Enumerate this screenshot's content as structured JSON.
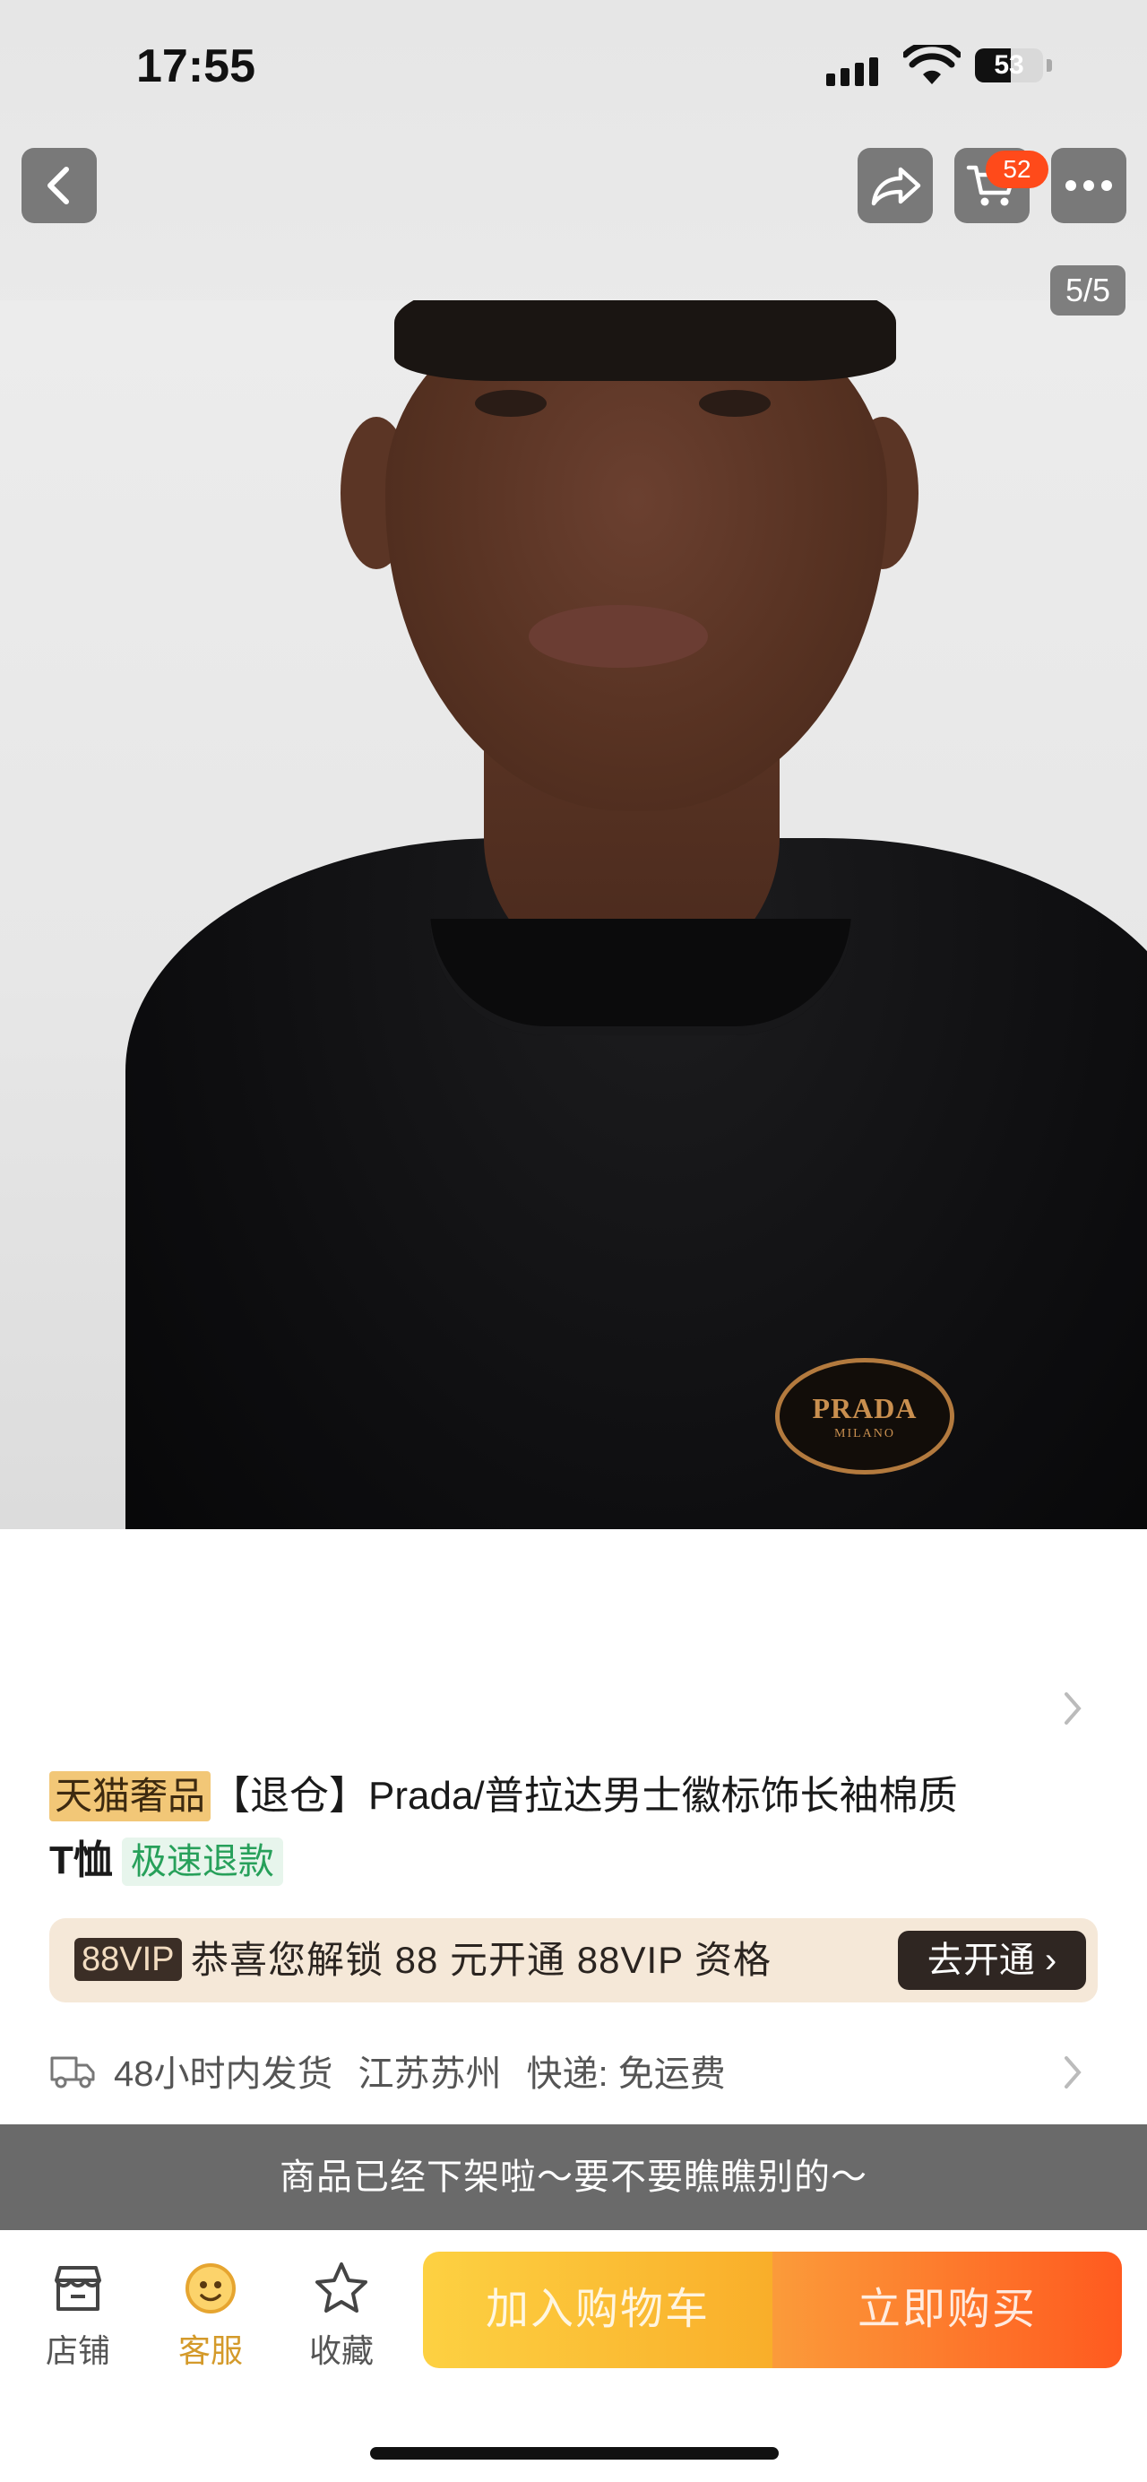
{
  "status_bar": {
    "time": "17:55",
    "battery": "53",
    "battery_level": 0.53
  },
  "header": {
    "cart_count": "52",
    "page_indicator": "5/5"
  },
  "product_image": {
    "badge_brand": "PRADA",
    "badge_city": "MILANO"
  },
  "product": {
    "tag": "天猫奢品",
    "title": "【退仓】Prada/普拉达男士徽标饰长袖棉质",
    "title_line2": "T恤",
    "refund_tag": "极速退款"
  },
  "vip": {
    "tag": "88VIP",
    "text": "恭喜您解锁 88 元开通 88VIP 资格",
    "button": "去开通 ›"
  },
  "shipping": {
    "time": "48小时内发货",
    "origin": "江苏苏州",
    "delivery": "快递: 免运费"
  },
  "banner": "商品已经下架啦～要不要瞧瞧别的～",
  "bottom_bar": {
    "store": "店铺",
    "service": "客服",
    "favorite": "收藏",
    "add_to_cart": "加入购物车",
    "buy_now": "立即购买"
  },
  "colors": {
    "accent_orange": "#ff5a1f",
    "accent_yellow": "#fdd142",
    "refund_green": "#27a05a",
    "tmall_gold": "#f2c777"
  }
}
